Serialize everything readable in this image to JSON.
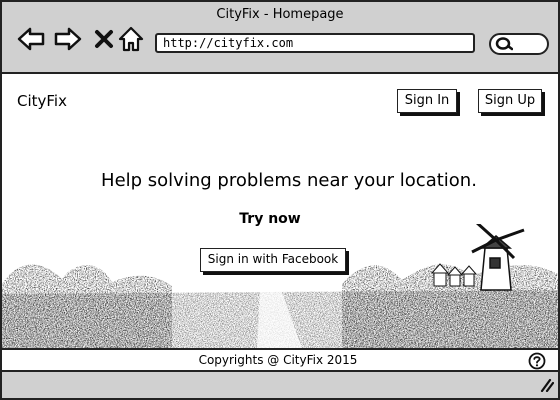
{
  "window": {
    "title": "CityFix - Homepage"
  },
  "browser": {
    "url": "http://cityfix.com",
    "icons": [
      "back-arrow-icon",
      "forward-arrow-icon",
      "close-x-icon",
      "home-icon",
      "search-icon"
    ]
  },
  "header": {
    "brand": "CityFix",
    "sign_in_label": "Sign In",
    "sign_up_label": "Sign Up"
  },
  "hero": {
    "tagline": "Help solving problems near your location.",
    "try_now": "Try now",
    "facebook_button": "Sign in with Facebook",
    "background": "landscape-with-windmill-image"
  },
  "footer": {
    "copyright": "Copyrights @ CityFix 2015",
    "help_icon": "help-icon"
  },
  "statusbar": {
    "resize_icon": "resize-grip-icon"
  },
  "colors": {
    "chrome": "#d0d0d0",
    "border": "#222222",
    "background": "#ffffff"
  }
}
